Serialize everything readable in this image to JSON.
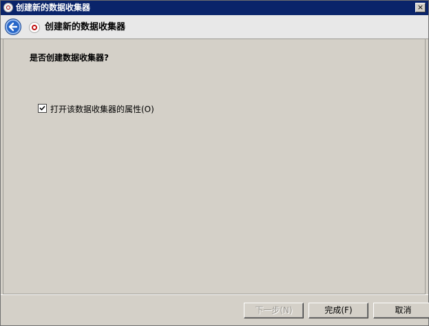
{
  "window": {
    "title": "创建新的数据收集器",
    "close_label": "×"
  },
  "header": {
    "title": "创建新的数据收集器"
  },
  "content": {
    "question": "是否创建数据收集器?",
    "checkbox_label": "打开该数据收集器的属性(O)",
    "checkbox_checked": true
  },
  "buttons": {
    "next": "下一步(N)",
    "finish": "完成(F)",
    "cancel": "取消"
  },
  "colors": {
    "titlebar": "#0a246a",
    "background": "#d4d0c8",
    "header": "#e8e8e8"
  }
}
